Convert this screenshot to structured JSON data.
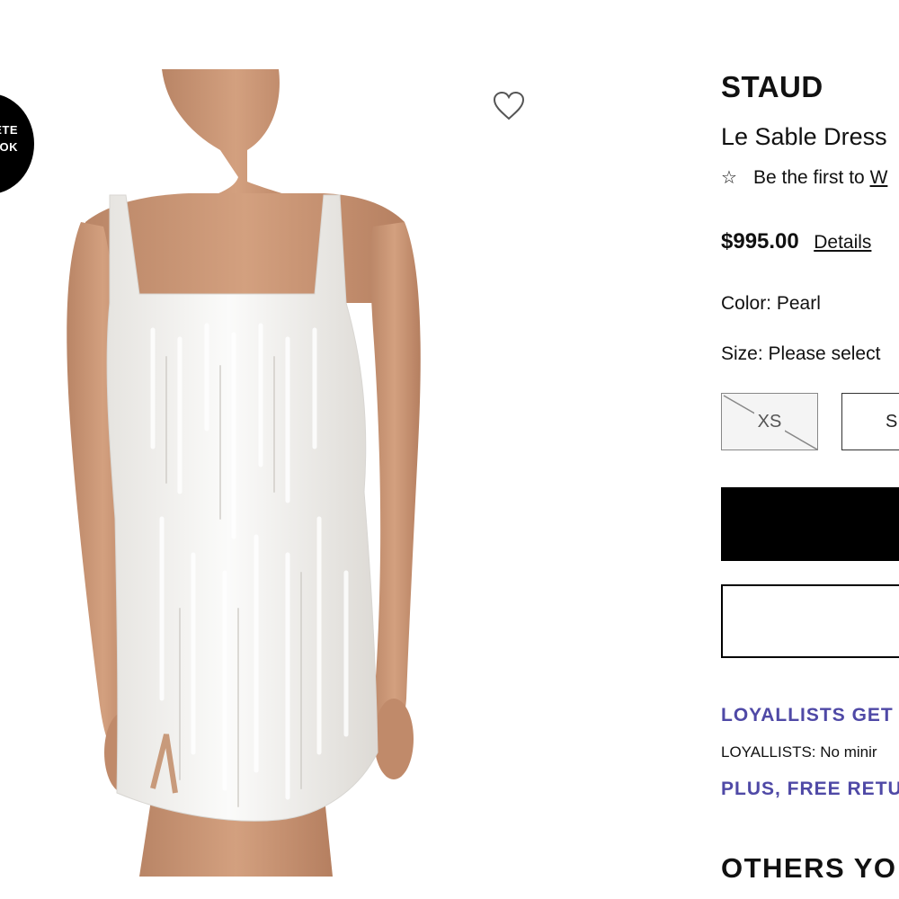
{
  "badge": {
    "line1": "ETE",
    "line2": "OK"
  },
  "product_image": {
    "icon": "product-photo",
    "alt": ""
  },
  "wishlist": {
    "icon": "heart-outline-icon"
  },
  "product": {
    "brand": "STAUD",
    "name": "Le Sable Dress",
    "review_prefix": "Be the first to ",
    "review_link": "W",
    "price": "$995.00",
    "details_label": "Details",
    "color_label": "Color:",
    "color_value": "Pearl",
    "size_label": "Size:",
    "size_value": "Please select"
  },
  "sizes": [
    {
      "label": "XS",
      "available": false
    },
    {
      "label": "S",
      "available": true
    }
  ],
  "actions": {
    "primary_label": "",
    "secondary_label": ""
  },
  "promo": {
    "line1": "LOYALLISTS GET",
    "line2": "LOYALLISTS: No minir",
    "line3": "PLUS, FREE RETU"
  },
  "section": {
    "others_title": "OTHERS YO"
  },
  "colors": {
    "accent": "#4f49a6",
    "black": "#000000",
    "disabled_bg": "#f4f4f4"
  }
}
